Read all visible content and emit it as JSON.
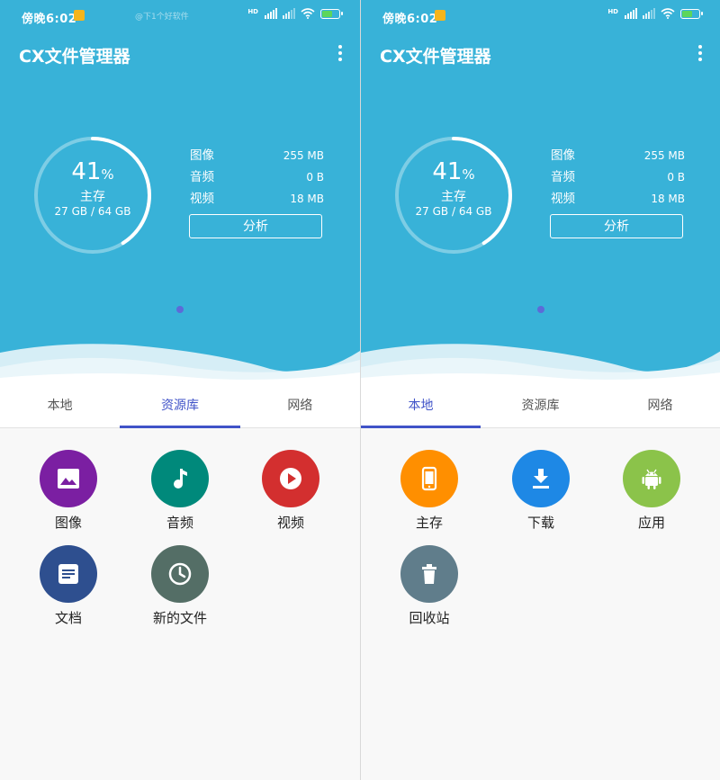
{
  "screens": [
    {
      "status": {
        "time": "傍晚6:02",
        "watermark": "@下1个好软件",
        "hd": "HD"
      },
      "app_title": "CX文件管理器",
      "storage": {
        "percent": "41",
        "percent_sign": "%",
        "percent_value": 41,
        "name": "主存",
        "capacity": "27 GB / 64 GB"
      },
      "stats": [
        {
          "label": "图像",
          "value": "255 MB"
        },
        {
          "label": "音频",
          "value": "0 B"
        },
        {
          "label": "视频",
          "value": "18 MB"
        }
      ],
      "analyze_label": "分析",
      "tabs": [
        {
          "label": "本地",
          "active": false
        },
        {
          "label": "资源库",
          "active": true
        },
        {
          "label": "网络",
          "active": false
        }
      ],
      "tiles": [
        {
          "label": "图像",
          "icon": "image-icon",
          "color": "#7b1fa2"
        },
        {
          "label": "音频",
          "icon": "music-note-icon",
          "color": "#00897b"
        },
        {
          "label": "视频",
          "icon": "play-icon",
          "color": "#d32f2f"
        },
        {
          "label": "文档",
          "icon": "document-icon",
          "color": "#2e4f8f"
        },
        {
          "label": "新的文件",
          "icon": "clock-icon",
          "color": "#546e66"
        }
      ]
    },
    {
      "status": {
        "time": "傍晚6:02",
        "hd": "HD"
      },
      "app_title": "CX文件管理器",
      "storage": {
        "percent": "41",
        "percent_sign": "%",
        "percent_value": 41,
        "name": "主存",
        "capacity": "27 GB / 64 GB"
      },
      "stats": [
        {
          "label": "图像",
          "value": "255 MB"
        },
        {
          "label": "音频",
          "value": "0 B"
        },
        {
          "label": "视频",
          "value": "18 MB"
        }
      ],
      "analyze_label": "分析",
      "tabs": [
        {
          "label": "本地",
          "active": true
        },
        {
          "label": "资源库",
          "active": false
        },
        {
          "label": "网络",
          "active": false
        }
      ],
      "tiles": [
        {
          "label": "主存",
          "icon": "phone-storage-icon",
          "color": "#ff8f00"
        },
        {
          "label": "下载",
          "icon": "download-icon",
          "color": "#1e88e5"
        },
        {
          "label": "应用",
          "icon": "android-icon",
          "color": "#8bc34a"
        },
        {
          "label": "回收站",
          "icon": "trash-icon",
          "color": "#607d8b"
        }
      ]
    }
  ]
}
